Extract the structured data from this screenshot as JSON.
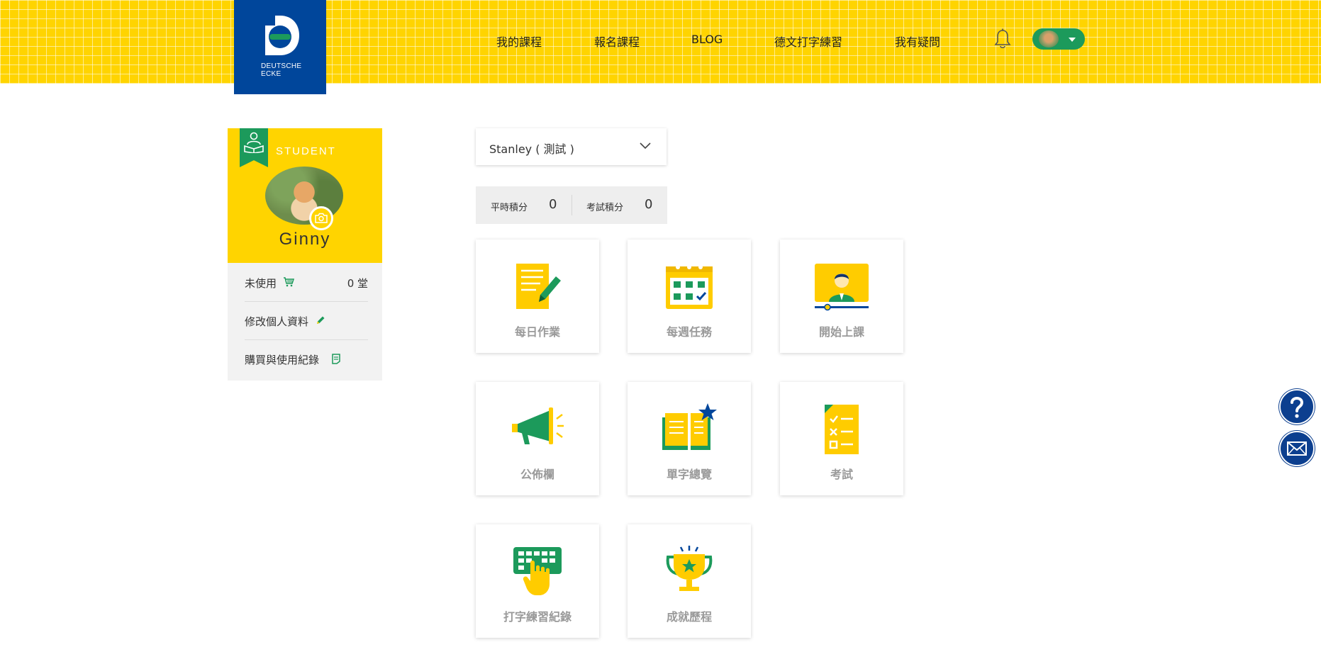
{
  "header": {
    "logo_text_line1": "DEUTSCHE",
    "logo_text_line2": "ECKE",
    "nav": [
      "我的課程",
      "報名課程",
      "BLOG",
      "德文打字練習",
      "我有疑問"
    ],
    "bell_icon": "bell-icon",
    "user_menu_icon": "caret-down-icon"
  },
  "profile": {
    "badge": "STUDENT",
    "name": "Ginny",
    "unused_label": "未使用",
    "unused_value": "0 堂",
    "edit_profile": "修改個人資料",
    "purchase_history": "購買與使用紀錄"
  },
  "student_select": {
    "selected": "Stanley ( 測試 )"
  },
  "scores": {
    "regular_label": "平時積分",
    "regular_value": "0",
    "exam_label": "考試積分",
    "exam_value": "0"
  },
  "tiles": [
    {
      "label": "每日作業",
      "icon": "homework-icon"
    },
    {
      "label": "每週任務",
      "icon": "calendar-icon"
    },
    {
      "label": "開始上課",
      "icon": "video-class-icon"
    },
    {
      "label": "公佈欄",
      "icon": "megaphone-icon"
    },
    {
      "label": "單字總覽",
      "icon": "vocabulary-book-icon"
    },
    {
      "label": "考試",
      "icon": "exam-checklist-icon"
    },
    {
      "label": "打字練習紀錄",
      "icon": "keyboard-icon"
    },
    {
      "label": "成就歷程",
      "icon": "trophy-icon"
    }
  ],
  "colors": {
    "brand_yellow": "#ffd400",
    "brand_blue": "#00469b",
    "brand_green": "#1c9a5b"
  }
}
